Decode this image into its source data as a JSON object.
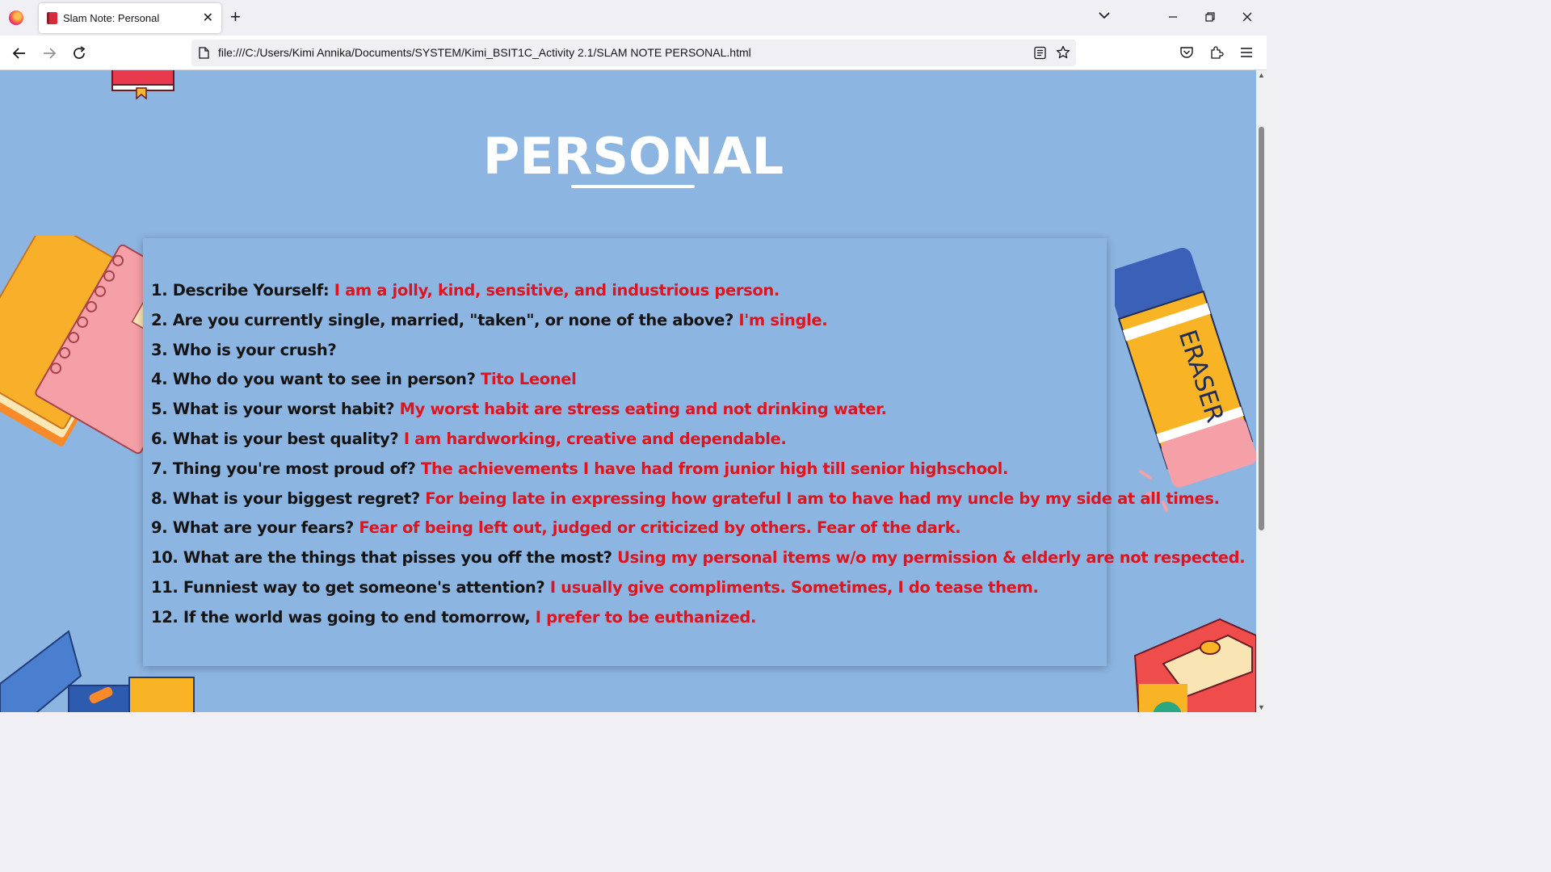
{
  "browser": {
    "tab_title": "Slam Note: Personal",
    "url": "file:///C:/Users/Kimi Annika/Documents/SYSTEM/Kimi_BSIT1C_Activity 2.1/SLAM NOTE PERSONAL.html"
  },
  "page": {
    "title": "PERSONAL",
    "background_color": "#8db5e2",
    "answer_color": "#e0141e",
    "eraser_label": "ERASER"
  },
  "questions": [
    {
      "q": "1. Describe Yourself:",
      "a": "I am a jolly, kind, sensitive, and industrious person."
    },
    {
      "q": "2. Are you currently single, married, \"taken\", or none of the above?",
      "a": "I'm single."
    },
    {
      "q": "3. Who is your crush?",
      "a": ""
    },
    {
      "q": "4. Who do you want to see in person?",
      "a": "Tito Leonel"
    },
    {
      "q": "5. What is your worst habit?",
      "a": "My worst habit are stress eating and not drinking water."
    },
    {
      "q": "6. What is your best quality?",
      "a": "I am hardworking, creative and dependable."
    },
    {
      "q": "7. Thing you're most proud of?",
      "a": "The achievements I have had from junior high till senior highschool."
    },
    {
      "q": "8. What is your biggest regret?",
      "a": "For being late in expressing how grateful I am to have had my uncle by my side at all times."
    },
    {
      "q": "9. What are your fears?",
      "a": "Fear of being left out, judged or criticized by others. Fear of the dark."
    },
    {
      "q": "10. What are the things that pisses you off the most?",
      "a": "Using my personal items w/o my permission & elderly are not respected."
    },
    {
      "q": "11. Funniest way to get someone's attention?",
      "a": "I usually give compliments. Sometimes, I do tease them."
    },
    {
      "q": "12. If the world was going to end tomorrow,",
      "a": "I prefer to be euthanized."
    }
  ]
}
